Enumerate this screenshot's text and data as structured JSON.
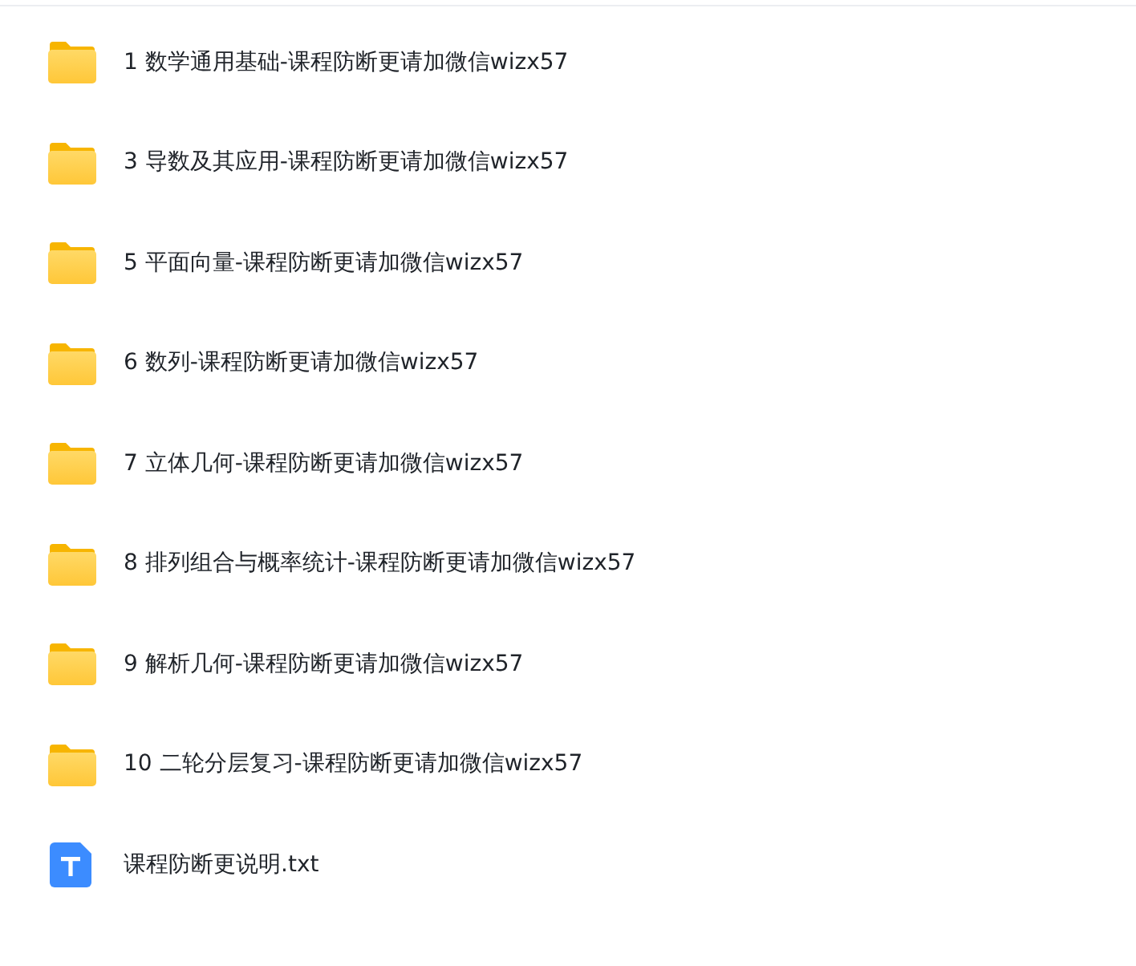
{
  "files": [
    {
      "kind": "folder",
      "name": "1 数学通用基础-课程防断更请加微信wizx57"
    },
    {
      "kind": "folder",
      "name": "3 导数及其应用-课程防断更请加微信wizx57"
    },
    {
      "kind": "folder",
      "name": "5 平面向量-课程防断更请加微信wizx57"
    },
    {
      "kind": "folder",
      "name": "6 数列-课程防断更请加微信wizx57"
    },
    {
      "kind": "folder",
      "name": "7 立体几何-课程防断更请加微信wizx57"
    },
    {
      "kind": "folder",
      "name": "8 排列组合与概率统计-课程防断更请加微信wizx57"
    },
    {
      "kind": "folder",
      "name": "9 解析几何-课程防断更请加微信wizx57"
    },
    {
      "kind": "folder",
      "name": "10 二轮分层复习-课程防断更请加微信wizx57"
    },
    {
      "kind": "text",
      "name": "课程防断更说明.txt"
    }
  ]
}
